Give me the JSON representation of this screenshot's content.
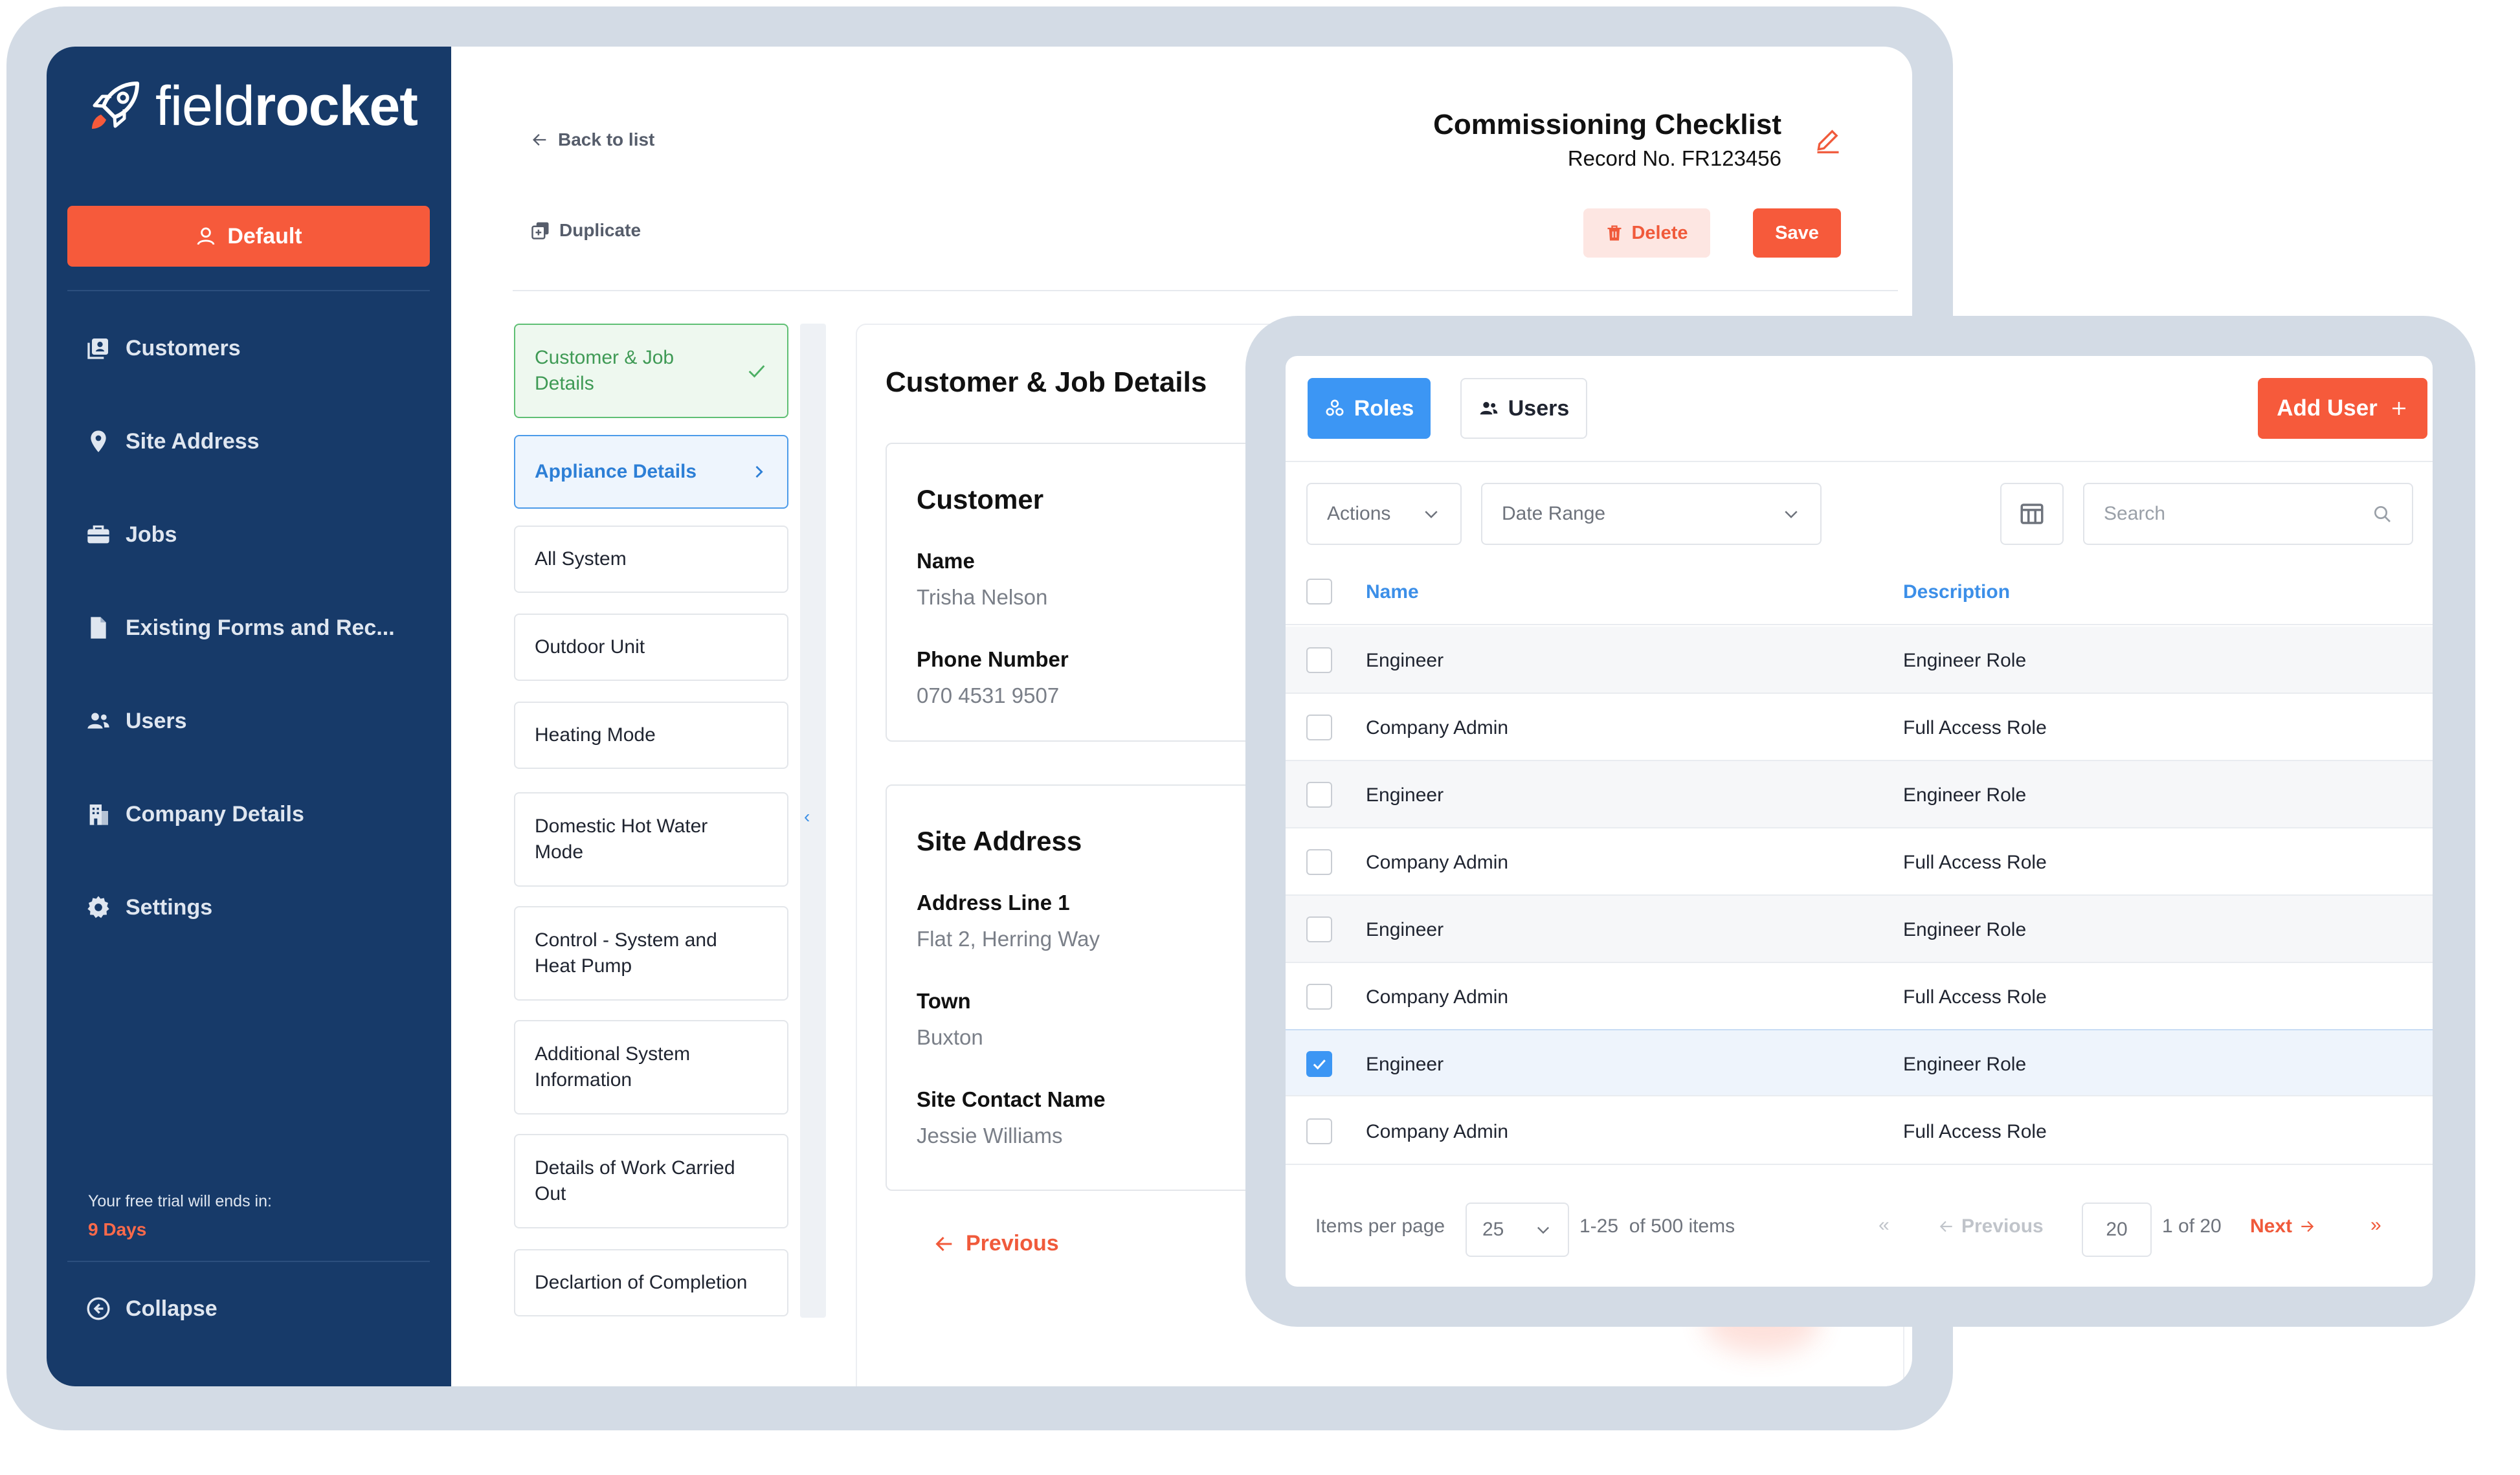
{
  "brand": {
    "logo_light": "field",
    "logo_bold": "rocket",
    "accent": "#f65a3b",
    "sidebar_bg": "#173a69",
    "blue": "#3c96f4"
  },
  "sidebar": {
    "default_button": "Default",
    "items": [
      {
        "label": "Customers",
        "icon": "customers-icon"
      },
      {
        "label": "Site Address",
        "icon": "location-pin-icon"
      },
      {
        "label": "Jobs",
        "icon": "briefcase-icon"
      },
      {
        "label": "Existing Forms and Rec...",
        "icon": "document-icon"
      },
      {
        "label": "Users",
        "icon": "users-icon"
      },
      {
        "label": "Company Details",
        "icon": "building-icon"
      },
      {
        "label": "Settings",
        "icon": "gear-icon"
      }
    ],
    "trial_text": "Your free trial will ends in:",
    "trial_days": "9 Days",
    "collapse": "Collapse"
  },
  "header": {
    "back": "Back to list",
    "duplicate": "Duplicate",
    "title": "Commissioning Checklist",
    "record": "Record No. FR123456",
    "delete": "Delete",
    "save": "Save"
  },
  "steps": [
    "Customer & Job Details",
    "Appliance Details",
    "All System",
    "Outdoor Unit",
    "Heating Mode",
    "Domestic Hot Water Mode",
    "Control - System and Heat Pump",
    "Additional System Information",
    "Details of Work Carried Out",
    "Declartion of Completion"
  ],
  "form": {
    "heading": "Customer & Job Details",
    "customer": {
      "title": "Customer",
      "name_label": "Name",
      "name_value": "Trisha Nelson",
      "phone_label": "Phone Number",
      "phone_value": "070 4531 9507"
    },
    "site": {
      "title": "Site Address",
      "addr_label": "Address Line 1",
      "addr_value": "Flat 2, Herring Way",
      "town_label": "Town",
      "town_value": "Buxton",
      "contact_label": "Site Contact Name",
      "contact_value": "Jessie Williams"
    },
    "previous": "Previous"
  },
  "roles_panel": {
    "tab_roles": "Roles",
    "tab_users": "Users",
    "add_user": "Add User",
    "actions": "Actions",
    "date_range": "Date Range",
    "search_placeholder": "Search",
    "columns": [
      "Name",
      "Description"
    ],
    "rows": [
      {
        "name": "Engineer",
        "desc": "Engineer Role",
        "checked": false
      },
      {
        "name": "Company Admin",
        "desc": "Full Access Role",
        "checked": false
      },
      {
        "name": "Engineer",
        "desc": "Engineer Role",
        "checked": false
      },
      {
        "name": "Company Admin",
        "desc": "Full Access Role",
        "checked": false
      },
      {
        "name": "Engineer",
        "desc": "Engineer Role",
        "checked": false
      },
      {
        "name": "Company Admin",
        "desc": "Full Access Role",
        "checked": false
      },
      {
        "name": "Engineer",
        "desc": "Engineer Role",
        "checked": true
      },
      {
        "name": "Company Admin",
        "desc": "Full Access Role",
        "checked": false
      }
    ],
    "pager": {
      "items_per_page": "Items per page",
      "per_page_value": "25",
      "range": "1-25  of 500 items",
      "previous": "Previous",
      "page_input": "20",
      "page_of": "1 of 20",
      "next": "Next"
    }
  }
}
